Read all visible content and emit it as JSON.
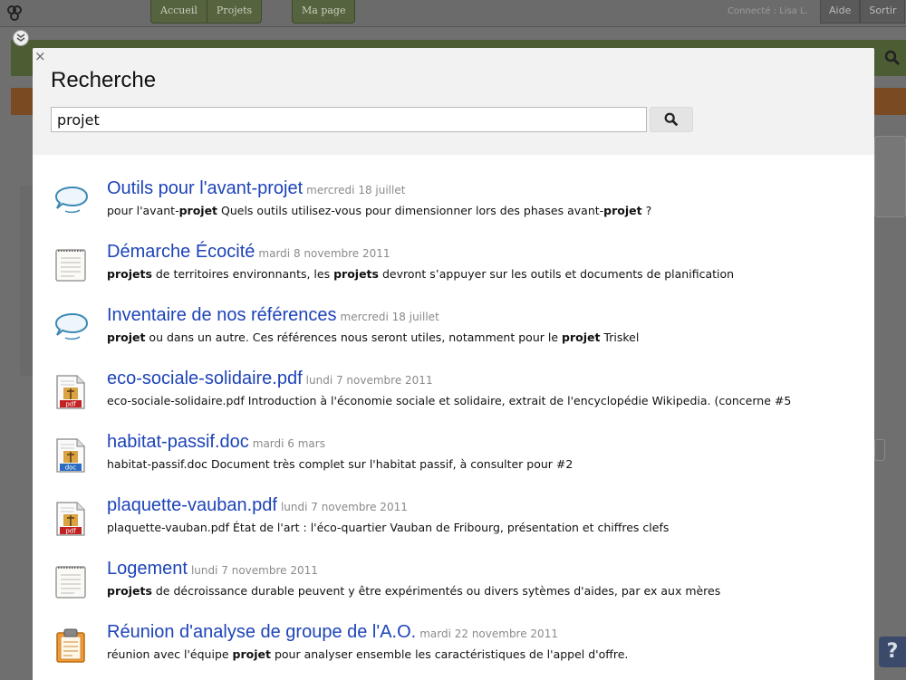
{
  "app": {
    "nav_left": [
      "Accueil",
      "Projets"
    ],
    "nav_mypage": "Ma page",
    "connected": "Connecté : Lisa L.",
    "nav_right": [
      "Aide",
      "Sortir"
    ],
    "help_label": "?"
  },
  "modal": {
    "title": "Recherche",
    "query": "projet",
    "close_label": "×"
  },
  "results": [
    {
      "icon": "discussion-icon",
      "title": "Outils pour l'avant-projet",
      "date": "mercredi 18 juillet",
      "snippet": [
        [
          "pour l'avant-",
          false
        ],
        [
          "projet",
          true
        ],
        [
          " Quels outils utilisez-vous pour dimensionner lors des phases avant-",
          false
        ],
        [
          "projet",
          true
        ],
        [
          " ?",
          false
        ]
      ]
    },
    {
      "icon": "page-icon",
      "title": "Démarche Écocité",
      "date": "mardi 8 novembre 2011",
      "snippet": [
        [
          "projets",
          true
        ],
        [
          " de territoires environnants, les ",
          false
        ],
        [
          "projets",
          true
        ],
        [
          " devront s’appuyer sur les outils et documents de planification",
          false
        ]
      ]
    },
    {
      "icon": "discussion-icon",
      "title": "Inventaire de nos références",
      "date": "mercredi 18 juillet",
      "snippet": [
        [
          "projet",
          true
        ],
        [
          " ou dans un autre. Ces références nous seront utiles, notamment pour le ",
          false
        ],
        [
          "projet",
          true
        ],
        [
          " Triskel",
          false
        ]
      ]
    },
    {
      "icon": "pdf-icon",
      "title": "eco-sociale-solidaire.pdf",
      "date": "lundi 7 novembre 2011",
      "snippet": [
        [
          "eco-sociale-solidaire.pdf Introduction à l'économie sociale et solidaire, extrait de l'encyclopédie Wikipedia. (concerne #5",
          false
        ]
      ]
    },
    {
      "icon": "doc-icon",
      "title": "habitat-passif.doc",
      "date": "mardi 6 mars",
      "snippet": [
        [
          "habitat-passif.doc Document très complet sur l'habitat passif, à consulter pour #2",
          false
        ]
      ]
    },
    {
      "icon": "pdf-icon",
      "title": "plaquette-vauban.pdf",
      "date": "lundi 7 novembre 2011",
      "snippet": [
        [
          "plaquette-vauban.pdf État de l'art : l'éco-quartier Vauban de Fribourg, présentation et chiffres clefs",
          false
        ]
      ]
    },
    {
      "icon": "page-icon",
      "title": "Logement",
      "date": "lundi 7 novembre 2011",
      "snippet": [
        [
          "projets",
          true
        ],
        [
          " de décroissance durable peuvent y être expérimentés ou divers sytèmes d'aides, par ex aux mères",
          false
        ]
      ]
    },
    {
      "icon": "clipboard-icon",
      "title": "Réunion d'analyse de groupe de l'A.O.",
      "date": "mardi 22 novembre 2011",
      "snippet": [
        [
          "réunion avec l'équipe ",
          false
        ],
        [
          "projet",
          true
        ],
        [
          " pour analyser ensemble les caractéristiques de l'appel d'offre.",
          false
        ]
      ]
    }
  ]
}
